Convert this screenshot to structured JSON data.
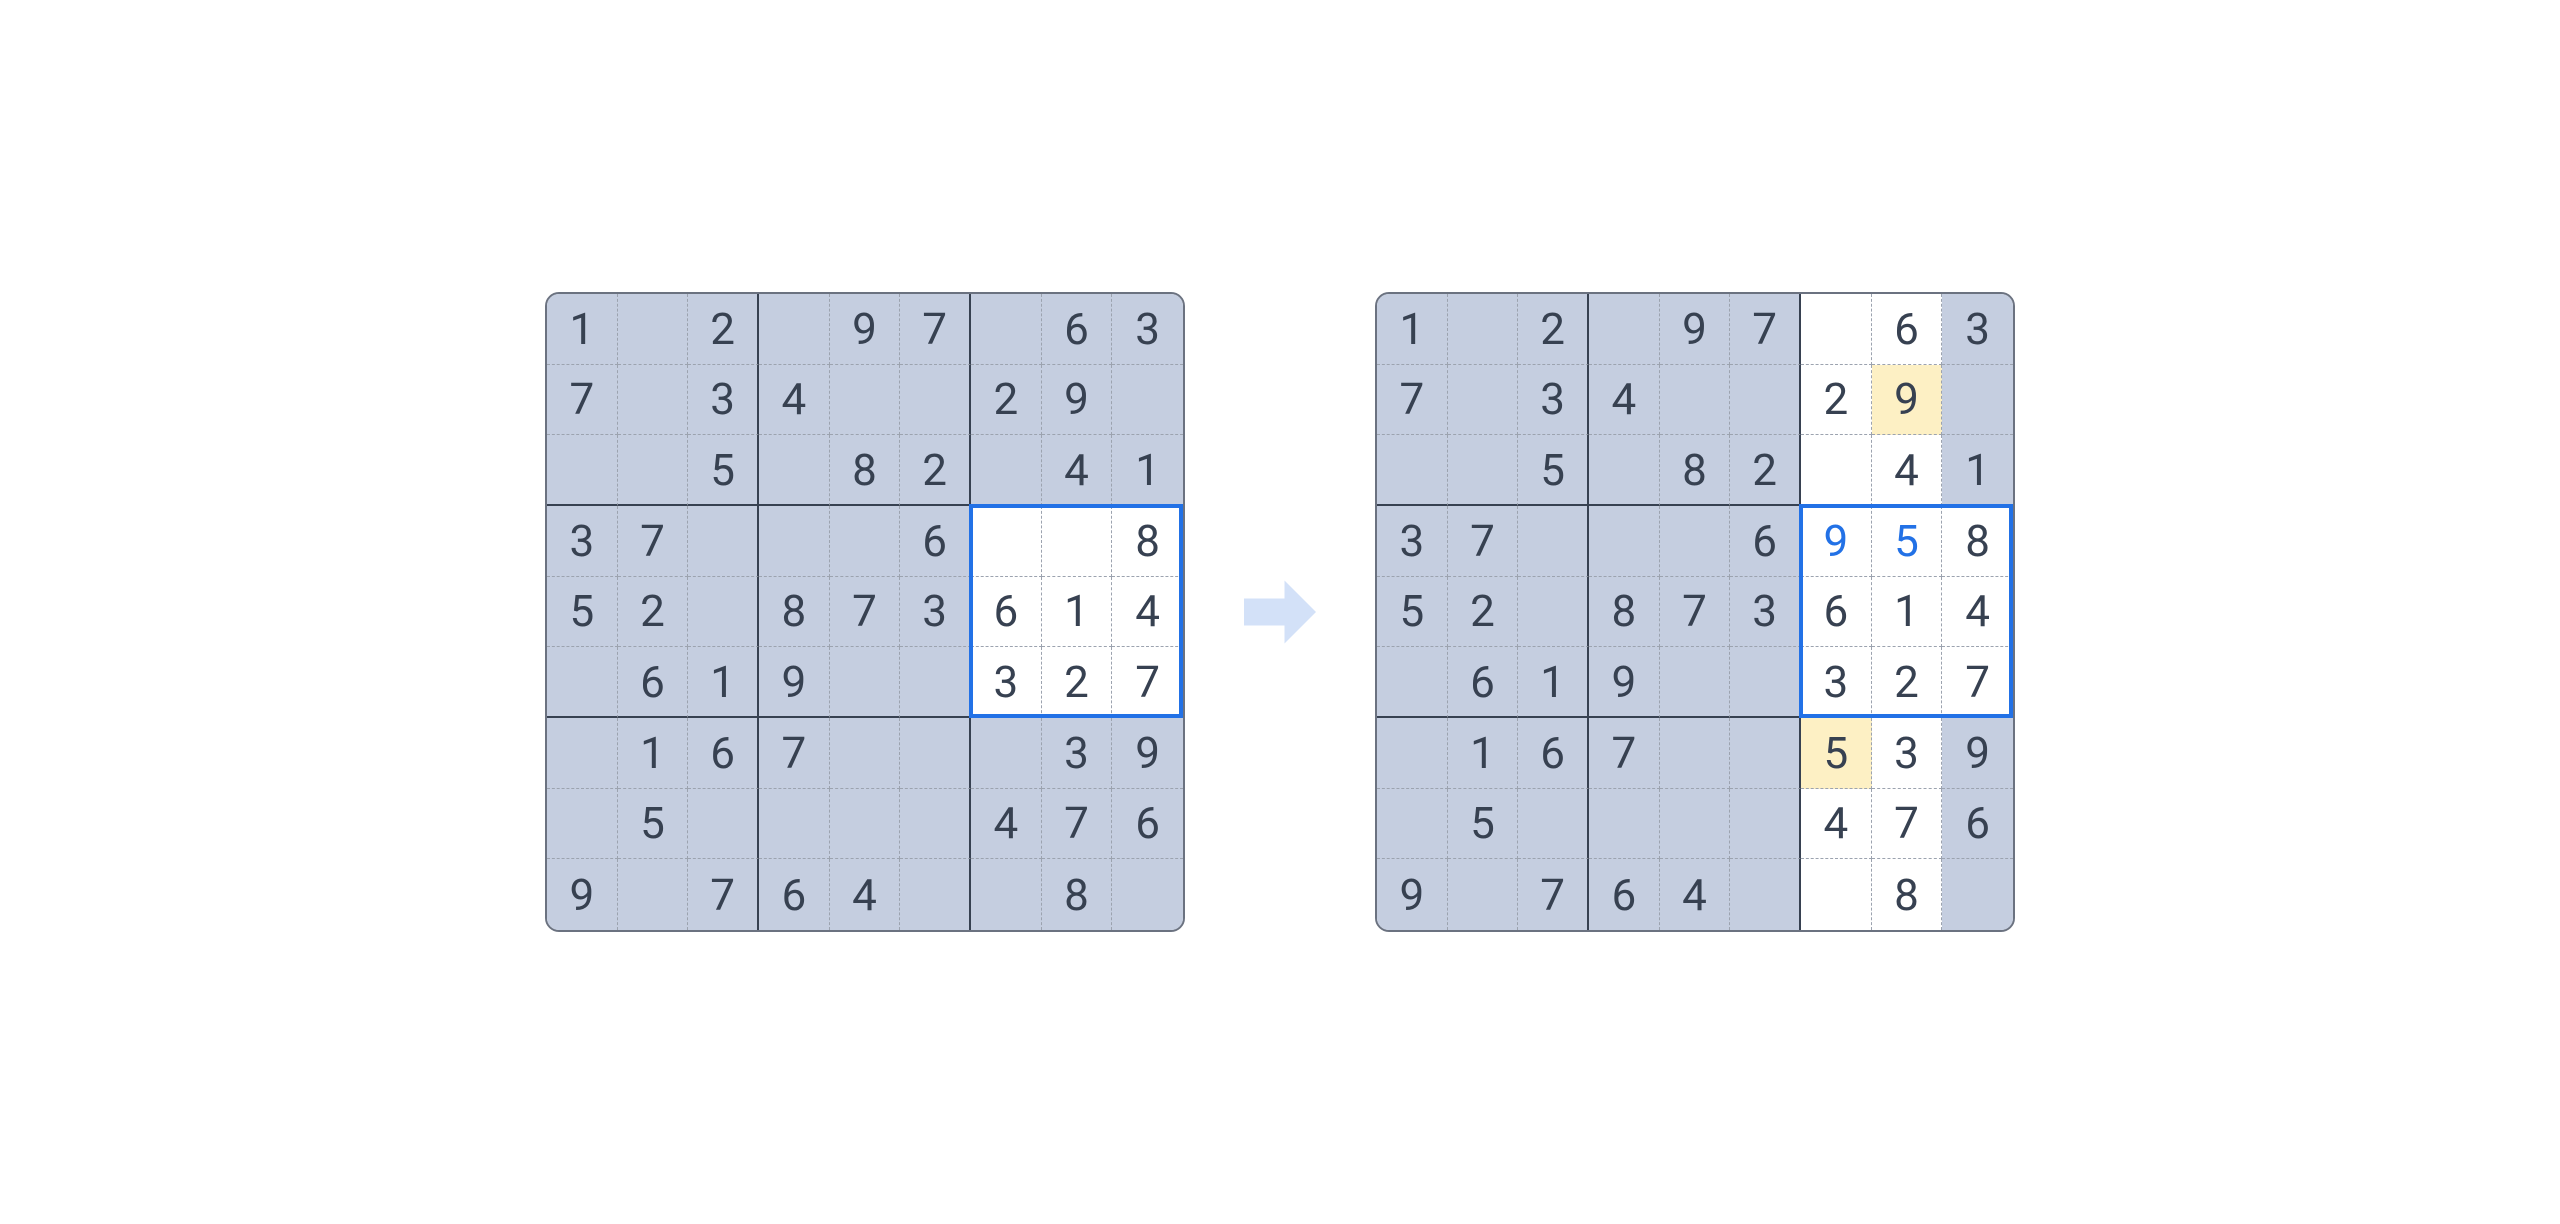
{
  "boards": {
    "left": {
      "grid": [
        [
          "1",
          "",
          "2",
          "",
          "9",
          "7",
          "",
          "6",
          "3"
        ],
        [
          "7",
          "",
          "3",
          "4",
          "",
          "",
          "2",
          "9",
          ""
        ],
        [
          "",
          "",
          "5",
          "",
          "8",
          "2",
          "",
          "4",
          "1"
        ],
        [
          "3",
          "7",
          "",
          "",
          "",
          "6",
          "",
          "",
          "8"
        ],
        [
          "5",
          "2",
          "",
          "8",
          "7",
          "3",
          "6",
          "1",
          "4"
        ],
        [
          "",
          "6",
          "1",
          "9",
          "",
          "",
          "3",
          "2",
          "7"
        ],
        [
          "",
          "1",
          "6",
          "7",
          "",
          "",
          "",
          "3",
          "9"
        ],
        [
          "",
          "5",
          "",
          "",
          "",
          "",
          "4",
          "7",
          "6"
        ],
        [
          "9",
          "",
          "7",
          "6",
          "4",
          "",
          "",
          "8",
          ""
        ]
      ],
      "highlights": {
        "plain_region": {
          "rows": [
            3,
            4,
            5
          ],
          "cols": [
            6,
            7,
            8
          ]
        },
        "blue_box": {
          "row_start": 3,
          "row_end": 5,
          "col_start": 6,
          "col_end": 8
        }
      }
    },
    "right": {
      "grid": [
        [
          "1",
          "",
          "2",
          "",
          "9",
          "7",
          "",
          "6",
          "3"
        ],
        [
          "7",
          "",
          "3",
          "4",
          "",
          "",
          "2",
          "9",
          ""
        ],
        [
          "",
          "",
          "5",
          "",
          "8",
          "2",
          "",
          "4",
          "1"
        ],
        [
          "3",
          "7",
          "",
          "",
          "",
          "6",
          "9",
          "5",
          "8"
        ],
        [
          "5",
          "2",
          "",
          "8",
          "7",
          "3",
          "6",
          "1",
          "4"
        ],
        [
          "",
          "6",
          "1",
          "9",
          "",
          "",
          "3",
          "2",
          "7"
        ],
        [
          "",
          "1",
          "6",
          "7",
          "",
          "",
          "5",
          "3",
          "9"
        ],
        [
          "",
          "5",
          "",
          "",
          "",
          "",
          "4",
          "7",
          "6"
        ],
        [
          "9",
          "",
          "7",
          "6",
          "4",
          "",
          "",
          "8",
          ""
        ]
      ],
      "highlights": {
        "plain_cols": [
          6,
          7
        ],
        "plain_region": {
          "rows": [
            3,
            4,
            5
          ],
          "cols": [
            6,
            7,
            8
          ]
        },
        "yellow_cells": [
          [
            1,
            7
          ],
          [
            6,
            6
          ]
        ],
        "blue_text_cells": [
          [
            3,
            6
          ],
          [
            3,
            7
          ]
        ],
        "blue_box": {
          "row_start": 3,
          "row_end": 5,
          "col_start": 6,
          "col_end": 8
        }
      }
    }
  },
  "arrow_color": "#d3e1f8"
}
